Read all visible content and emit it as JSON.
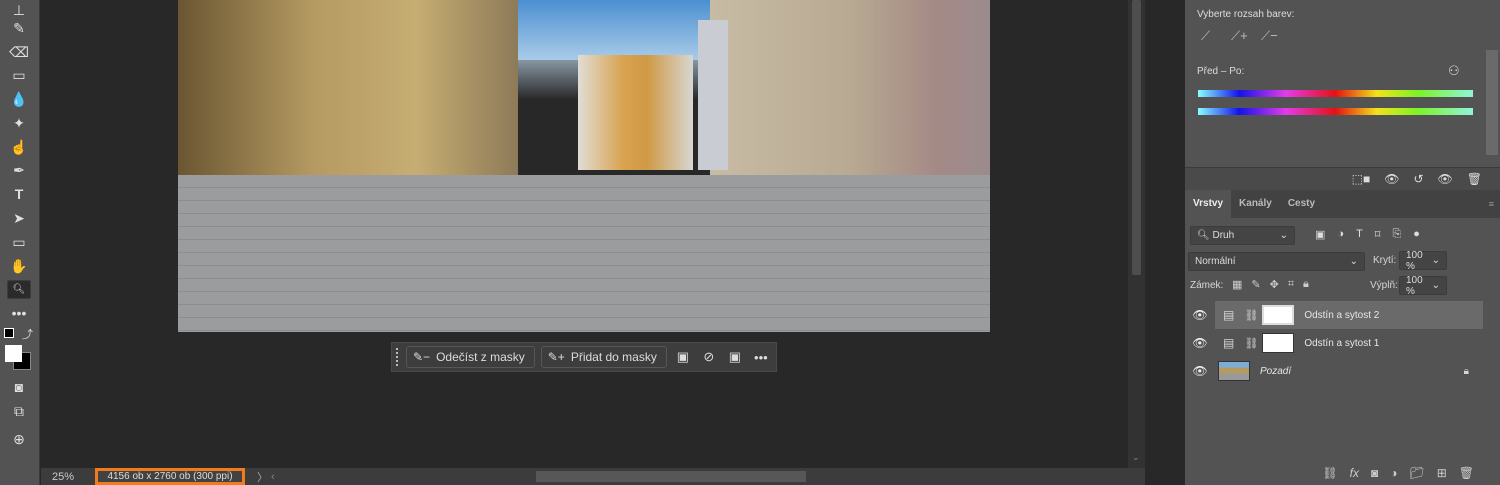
{
  "toolbar": {
    "tools": [
      "stamp-tool",
      "history-brush-tool",
      "eraser-tool",
      "gradient-tool",
      "blur-tool",
      "dodge-tool",
      "smudge-tool",
      "pen-tool",
      "type-tool",
      "path-selection-tool",
      "rectangle-tool",
      "hand-tool",
      "zoom-tool",
      "more-tools"
    ],
    "selected": "zoom-tool"
  },
  "contextual_taskbar": {
    "subtract": "Odečíst z masky",
    "add": "Přidat do masky"
  },
  "status": {
    "zoom": "25%",
    "doc_info": "4156 ob x 2760 ob (300 ppi)"
  },
  "properties": {
    "color_range_label": "Vyberte rozsah barev:",
    "before_after_label": "Před – Po:"
  },
  "layers_panel": {
    "tabs": [
      "Vrstvy",
      "Kanály",
      "Cesty"
    ],
    "active_tab": "Vrstvy",
    "filter": "Druh",
    "blend_mode": "Normální",
    "opacity_label": "Krytí:",
    "opacity": "100 %",
    "lock_label": "Zámek:",
    "fill_label": "Výplň:",
    "fill": "100 %",
    "layers": [
      {
        "name": "Odstín a sytost 2",
        "selected": true
      },
      {
        "name": "Odstín a sytost 1",
        "selected": false
      },
      {
        "name": "Pozadí",
        "selected": false,
        "locked": true
      }
    ]
  },
  "colors": {
    "highlight": "#f27c1d"
  }
}
